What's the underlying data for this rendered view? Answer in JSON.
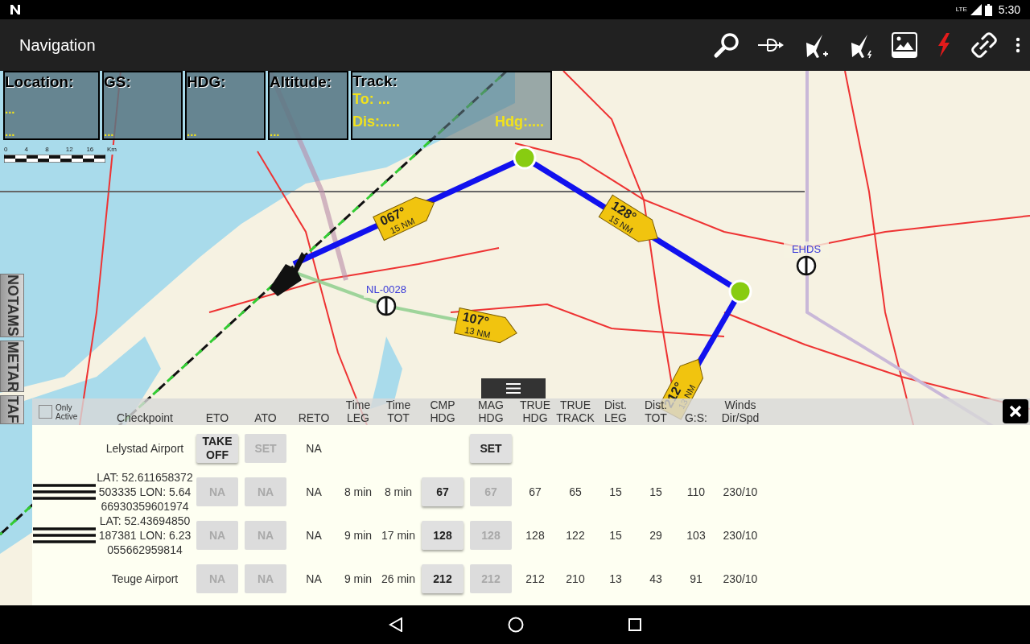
{
  "status_bar": {
    "network": "LTE",
    "time": "5:30"
  },
  "app_bar": {
    "title": "Navigation"
  },
  "info_boxes": [
    {
      "label": "Location:",
      "values": [
        "...",
        "..."
      ]
    },
    {
      "label": "GS:",
      "values": [
        "..."
      ]
    },
    {
      "label": "HDG:",
      "values": [
        "..."
      ]
    },
    {
      "label": "Altitude:",
      "values": [
        "..."
      ]
    }
  ],
  "track_box": {
    "label": "Track:",
    "to": "To: ...",
    "dis": "Dis:.....",
    "hdg": "Hdg:...."
  },
  "scale": {
    "ticks": [
      "0",
      "4",
      "8",
      "12",
      "16"
    ],
    "unit": "Km"
  },
  "map": {
    "waypoints": [
      {
        "label": "EHDS"
      },
      {
        "label": "NL-0028"
      }
    ],
    "legs": [
      {
        "heading": "067°",
        "distance": "15 NM"
      },
      {
        "heading": "128°",
        "distance": "15 NM"
      },
      {
        "heading": "107°",
        "distance": "13 NM"
      },
      {
        "heading": "212°",
        "distance": "13 NM"
      }
    ]
  },
  "side_tabs": [
    "NOTAMS",
    "METAR",
    "TAF"
  ],
  "table": {
    "only_active": {
      "label": "Only\nActive",
      "checked": false
    },
    "columns": [
      "Checkpoint",
      "ETO",
      "ATO",
      "RETO",
      "Time\nLEG",
      "Time\nTOT",
      "CMP\nHDG",
      "MAG\nHDG",
      "TRUE\nHDG",
      "TRUE\nTRACK",
      "Dist.\nLEG",
      "Dist.\nTOT",
      "G:S:",
      "Winds\nDir/Spd"
    ],
    "rows": [
      {
        "handle": false,
        "checkpoint": "Lelystad Airport",
        "eto": {
          "text": "TAKE\nOFF",
          "enabled": true
        },
        "ato": {
          "text": "SET",
          "enabled": false
        },
        "reto": "NA",
        "mag_hdg": {
          "text": "SET",
          "enabled": true
        }
      },
      {
        "handle": true,
        "checkpoint": "LAT: 52.611658372503335 LON: 5.6466930359601974",
        "eto": {
          "text": "NA",
          "enabled": false
        },
        "ato": {
          "text": "NA",
          "enabled": false
        },
        "reto": "NA",
        "time_leg": "8 min",
        "time_tot": "8 min",
        "cmp_hdg": {
          "text": "67",
          "enabled": true
        },
        "mag_hdg": {
          "text": "67",
          "enabled": false
        },
        "true_hdg": "67",
        "true_track": "65",
        "dist_leg": "15",
        "dist_tot": "15",
        "gs": "110",
        "winds": "230/10"
      },
      {
        "handle": true,
        "checkpoint": "LAT: 52.43694850187381 LON: 6.23055662959814",
        "eto": {
          "text": "NA",
          "enabled": false
        },
        "ato": {
          "text": "NA",
          "enabled": false
        },
        "reto": "NA",
        "time_leg": "9 min",
        "time_tot": "17 min",
        "cmp_hdg": {
          "text": "128",
          "enabled": true
        },
        "mag_hdg": {
          "text": "128",
          "enabled": false
        },
        "true_hdg": "128",
        "true_track": "122",
        "dist_leg": "15",
        "dist_tot": "29",
        "gs": "103",
        "winds": "230/10"
      },
      {
        "handle": false,
        "checkpoint": "Teuge Airport",
        "eto": {
          "text": "NA",
          "enabled": false
        },
        "ato": {
          "text": "NA",
          "enabled": false
        },
        "reto": "NA",
        "time_leg": "9 min",
        "time_tot": "26 min",
        "cmp_hdg": {
          "text": "212",
          "enabled": true
        },
        "mag_hdg": {
          "text": "212",
          "enabled": false
        },
        "true_hdg": "212",
        "true_track": "210",
        "dist_leg": "13",
        "dist_tot": "43",
        "gs": "91",
        "winds": "230/10"
      }
    ]
  }
}
